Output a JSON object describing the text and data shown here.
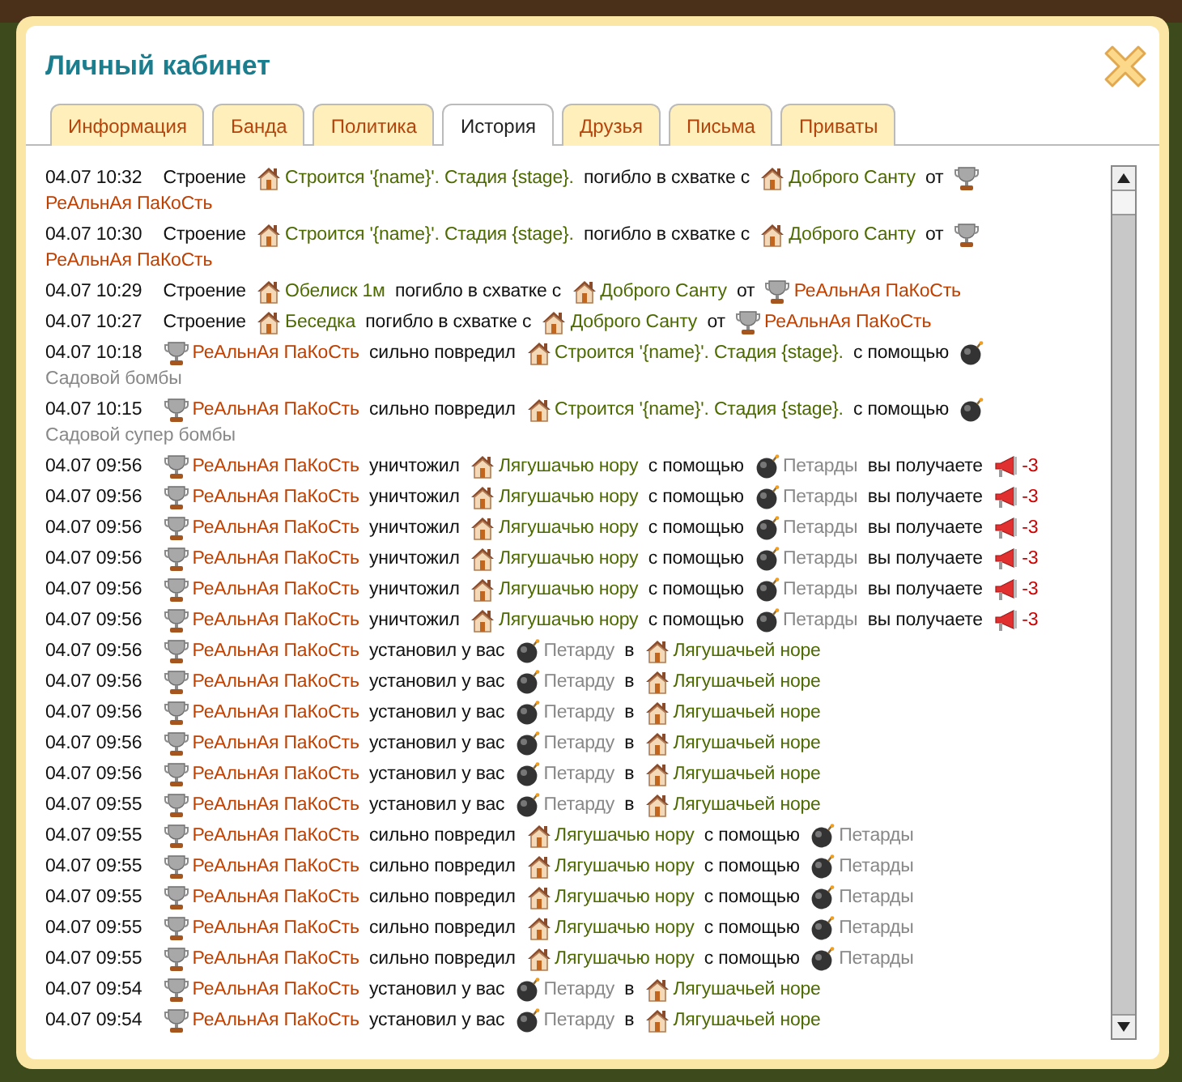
{
  "window": {
    "title": "Личный кабинет"
  },
  "tabs": [
    {
      "label": "Информация",
      "selected": false
    },
    {
      "label": "Банда",
      "selected": false
    },
    {
      "label": "Политика",
      "selected": false
    },
    {
      "label": "История",
      "selected": true
    },
    {
      "label": "Друзья",
      "selected": false
    },
    {
      "label": "Письма",
      "selected": false
    },
    {
      "label": "Приваты",
      "selected": false
    }
  ],
  "history": [
    {
      "time": "04.07 10:32",
      "parts": [
        {
          "kind": "text",
          "text": "Строение"
        },
        {
          "kind": "building",
          "text": "Строится '{name}'. Стадия {stage}."
        },
        {
          "kind": "text",
          "text": "погибло в схватке с"
        },
        {
          "kind": "building",
          "text": "Доброго Санту"
        },
        {
          "kind": "text",
          "text": "от"
        },
        {
          "kind": "user",
          "text": "РеАльнАя ПаКоСть"
        }
      ]
    },
    {
      "time": "04.07 10:30",
      "parts": [
        {
          "kind": "text",
          "text": "Строение"
        },
        {
          "kind": "building",
          "text": "Строится '{name}'. Стадия {stage}."
        },
        {
          "kind": "text",
          "text": "погибло в схватке с"
        },
        {
          "kind": "building",
          "text": "Доброго Санту"
        },
        {
          "kind": "text",
          "text": "от"
        },
        {
          "kind": "user",
          "text": "РеАльнАя ПаКоСть"
        }
      ]
    },
    {
      "time": "04.07 10:29",
      "parts": [
        {
          "kind": "text",
          "text": "Строение"
        },
        {
          "kind": "building",
          "text": "Обелиск 1м"
        },
        {
          "kind": "text",
          "text": "погибло в схватке с"
        },
        {
          "kind": "building",
          "text": "Доброго Санту"
        },
        {
          "kind": "text",
          "text": "от"
        },
        {
          "kind": "user",
          "text": "РеАльнАя ПаКоСть"
        }
      ]
    },
    {
      "time": "04.07 10:27",
      "parts": [
        {
          "kind": "text",
          "text": "Строение"
        },
        {
          "kind": "building",
          "text": "Беседка"
        },
        {
          "kind": "text",
          "text": "погибло в схватке с"
        },
        {
          "kind": "building",
          "text": "Доброго Санту"
        },
        {
          "kind": "text",
          "text": "от"
        },
        {
          "kind": "user",
          "text": "РеАльнАя ПаКоСть"
        }
      ]
    },
    {
      "time": "04.07 10:18",
      "parts": [
        {
          "kind": "user",
          "text": "РеАльнАя ПаКоСть"
        },
        {
          "kind": "text",
          "text": "сильно повредил"
        },
        {
          "kind": "building",
          "text": "Строится '{name}'. Стадия {stage}."
        },
        {
          "kind": "text",
          "text": "с помощью"
        },
        {
          "kind": "weapon",
          "text": "Садовой бомбы"
        }
      ]
    },
    {
      "time": "04.07 10:15",
      "parts": [
        {
          "kind": "user",
          "text": "РеАльнАя ПаКоСть"
        },
        {
          "kind": "text",
          "text": "сильно повредил"
        },
        {
          "kind": "building",
          "text": "Строится '{name}'. Стадия {stage}."
        },
        {
          "kind": "text",
          "text": "с помощью"
        },
        {
          "kind": "weapon",
          "text": "Садовой супер бомбы"
        }
      ]
    },
    {
      "time": "04.07 09:56",
      "parts": [
        {
          "kind": "user",
          "text": "РеАльнАя ПаКоСть"
        },
        {
          "kind": "text",
          "text": "уничтожил"
        },
        {
          "kind": "building",
          "text": "Лягушачью нору"
        },
        {
          "kind": "text",
          "text": "с помощью"
        },
        {
          "kind": "weapon",
          "text": "Петарды"
        },
        {
          "kind": "text",
          "text": "вы получаете"
        },
        {
          "kind": "points",
          "text": "-3"
        }
      ]
    },
    {
      "time": "04.07 09:56",
      "parts": [
        {
          "kind": "user",
          "text": "РеАльнАя ПаКоСть"
        },
        {
          "kind": "text",
          "text": "уничтожил"
        },
        {
          "kind": "building",
          "text": "Лягушачью нору"
        },
        {
          "kind": "text",
          "text": "с помощью"
        },
        {
          "kind": "weapon",
          "text": "Петарды"
        },
        {
          "kind": "text",
          "text": "вы получаете"
        },
        {
          "kind": "points",
          "text": "-3"
        }
      ]
    },
    {
      "time": "04.07 09:56",
      "parts": [
        {
          "kind": "user",
          "text": "РеАльнАя ПаКоСть"
        },
        {
          "kind": "text",
          "text": "уничтожил"
        },
        {
          "kind": "building",
          "text": "Лягушачью нору"
        },
        {
          "kind": "text",
          "text": "с помощью"
        },
        {
          "kind": "weapon",
          "text": "Петарды"
        },
        {
          "kind": "text",
          "text": "вы получаете"
        },
        {
          "kind": "points",
          "text": "-3"
        }
      ]
    },
    {
      "time": "04.07 09:56",
      "parts": [
        {
          "kind": "user",
          "text": "РеАльнАя ПаКоСть"
        },
        {
          "kind": "text",
          "text": "уничтожил"
        },
        {
          "kind": "building",
          "text": "Лягушачью нору"
        },
        {
          "kind": "text",
          "text": "с помощью"
        },
        {
          "kind": "weapon",
          "text": "Петарды"
        },
        {
          "kind": "text",
          "text": "вы получаете"
        },
        {
          "kind": "points",
          "text": "-3"
        }
      ]
    },
    {
      "time": "04.07 09:56",
      "parts": [
        {
          "kind": "user",
          "text": "РеАльнАя ПаКоСть"
        },
        {
          "kind": "text",
          "text": "уничтожил"
        },
        {
          "kind": "building",
          "text": "Лягушачью нору"
        },
        {
          "kind": "text",
          "text": "с помощью"
        },
        {
          "kind": "weapon",
          "text": "Петарды"
        },
        {
          "kind": "text",
          "text": "вы получаете"
        },
        {
          "kind": "points",
          "text": "-3"
        }
      ]
    },
    {
      "time": "04.07 09:56",
      "parts": [
        {
          "kind": "user",
          "text": "РеАльнАя ПаКоСть"
        },
        {
          "kind": "text",
          "text": "уничтожил"
        },
        {
          "kind": "building",
          "text": "Лягушачью нору"
        },
        {
          "kind": "text",
          "text": "с помощью"
        },
        {
          "kind": "weapon",
          "text": "Петарды"
        },
        {
          "kind": "text",
          "text": "вы получаете"
        },
        {
          "kind": "points",
          "text": "-3"
        }
      ]
    },
    {
      "time": "04.07 09:56",
      "parts": [
        {
          "kind": "user",
          "text": "РеАльнАя ПаКоСть"
        },
        {
          "kind": "text",
          "text": "установил у вас"
        },
        {
          "kind": "weapon",
          "text": "Петарду"
        },
        {
          "kind": "text",
          "text": "в"
        },
        {
          "kind": "building",
          "text": "Лягушачьей норе"
        }
      ]
    },
    {
      "time": "04.07 09:56",
      "parts": [
        {
          "kind": "user",
          "text": "РеАльнАя ПаКоСть"
        },
        {
          "kind": "text",
          "text": "установил у вас"
        },
        {
          "kind": "weapon",
          "text": "Петарду"
        },
        {
          "kind": "text",
          "text": "в"
        },
        {
          "kind": "building",
          "text": "Лягушачьей норе"
        }
      ]
    },
    {
      "time": "04.07 09:56",
      "parts": [
        {
          "kind": "user",
          "text": "РеАльнАя ПаКоСть"
        },
        {
          "kind": "text",
          "text": "установил у вас"
        },
        {
          "kind": "weapon",
          "text": "Петарду"
        },
        {
          "kind": "text",
          "text": "в"
        },
        {
          "kind": "building",
          "text": "Лягушачьей норе"
        }
      ]
    },
    {
      "time": "04.07 09:56",
      "parts": [
        {
          "kind": "user",
          "text": "РеАльнАя ПаКоСть"
        },
        {
          "kind": "text",
          "text": "установил у вас"
        },
        {
          "kind": "weapon",
          "text": "Петарду"
        },
        {
          "kind": "text",
          "text": "в"
        },
        {
          "kind": "building",
          "text": "Лягушачьей норе"
        }
      ]
    },
    {
      "time": "04.07 09:56",
      "parts": [
        {
          "kind": "user",
          "text": "РеАльнАя ПаКоСть"
        },
        {
          "kind": "text",
          "text": "установил у вас"
        },
        {
          "kind": "weapon",
          "text": "Петарду"
        },
        {
          "kind": "text",
          "text": "в"
        },
        {
          "kind": "building",
          "text": "Лягушачьей норе"
        }
      ]
    },
    {
      "time": "04.07 09:55",
      "parts": [
        {
          "kind": "user",
          "text": "РеАльнАя ПаКоСть"
        },
        {
          "kind": "text",
          "text": "установил у вас"
        },
        {
          "kind": "weapon",
          "text": "Петарду"
        },
        {
          "kind": "text",
          "text": "в"
        },
        {
          "kind": "building",
          "text": "Лягушачьей норе"
        }
      ]
    },
    {
      "time": "04.07 09:55",
      "parts": [
        {
          "kind": "user",
          "text": "РеАльнАя ПаКоСть"
        },
        {
          "kind": "text",
          "text": "сильно повредил"
        },
        {
          "kind": "building",
          "text": "Лягушачью нору"
        },
        {
          "kind": "text",
          "text": "с помощью"
        },
        {
          "kind": "weapon",
          "text": "Петарды"
        }
      ]
    },
    {
      "time": "04.07 09:55",
      "parts": [
        {
          "kind": "user",
          "text": "РеАльнАя ПаКоСть"
        },
        {
          "kind": "text",
          "text": "сильно повредил"
        },
        {
          "kind": "building",
          "text": "Лягушачью нору"
        },
        {
          "kind": "text",
          "text": "с помощью"
        },
        {
          "kind": "weapon",
          "text": "Петарды"
        }
      ]
    },
    {
      "time": "04.07 09:55",
      "parts": [
        {
          "kind": "user",
          "text": "РеАльнАя ПаКоСть"
        },
        {
          "kind": "text",
          "text": "сильно повредил"
        },
        {
          "kind": "building",
          "text": "Лягушачью нору"
        },
        {
          "kind": "text",
          "text": "с помощью"
        },
        {
          "kind": "weapon",
          "text": "Петарды"
        }
      ]
    },
    {
      "time": "04.07 09:55",
      "parts": [
        {
          "kind": "user",
          "text": "РеАльнАя ПаКоСть"
        },
        {
          "kind": "text",
          "text": "сильно повредил"
        },
        {
          "kind": "building",
          "text": "Лягушачью нору"
        },
        {
          "kind": "text",
          "text": "с помощью"
        },
        {
          "kind": "weapon",
          "text": "Петарды"
        }
      ]
    },
    {
      "time": "04.07 09:55",
      "parts": [
        {
          "kind": "user",
          "text": "РеАльнАя ПаКоСть"
        },
        {
          "kind": "text",
          "text": "сильно повредил"
        },
        {
          "kind": "building",
          "text": "Лягушачью нору"
        },
        {
          "kind": "text",
          "text": "с помощью"
        },
        {
          "kind": "weapon",
          "text": "Петарды"
        }
      ]
    },
    {
      "time": "04.07 09:54",
      "parts": [
        {
          "kind": "user",
          "text": "РеАльнАя ПаКоСть"
        },
        {
          "kind": "text",
          "text": "установил у вас"
        },
        {
          "kind": "weapon",
          "text": "Петарду"
        },
        {
          "kind": "text",
          "text": "в"
        },
        {
          "kind": "building",
          "text": "Лягушачьей норе"
        }
      ]
    },
    {
      "time": "04.07 09:54",
      "parts": [
        {
          "kind": "user",
          "text": "РеАльнАя ПаКоСть"
        },
        {
          "kind": "text",
          "text": "установил у вас"
        },
        {
          "kind": "weapon",
          "text": "Петарду"
        },
        {
          "kind": "text",
          "text": "в"
        },
        {
          "kind": "building",
          "text": "Лягушачьей норе"
        }
      ]
    }
  ]
}
